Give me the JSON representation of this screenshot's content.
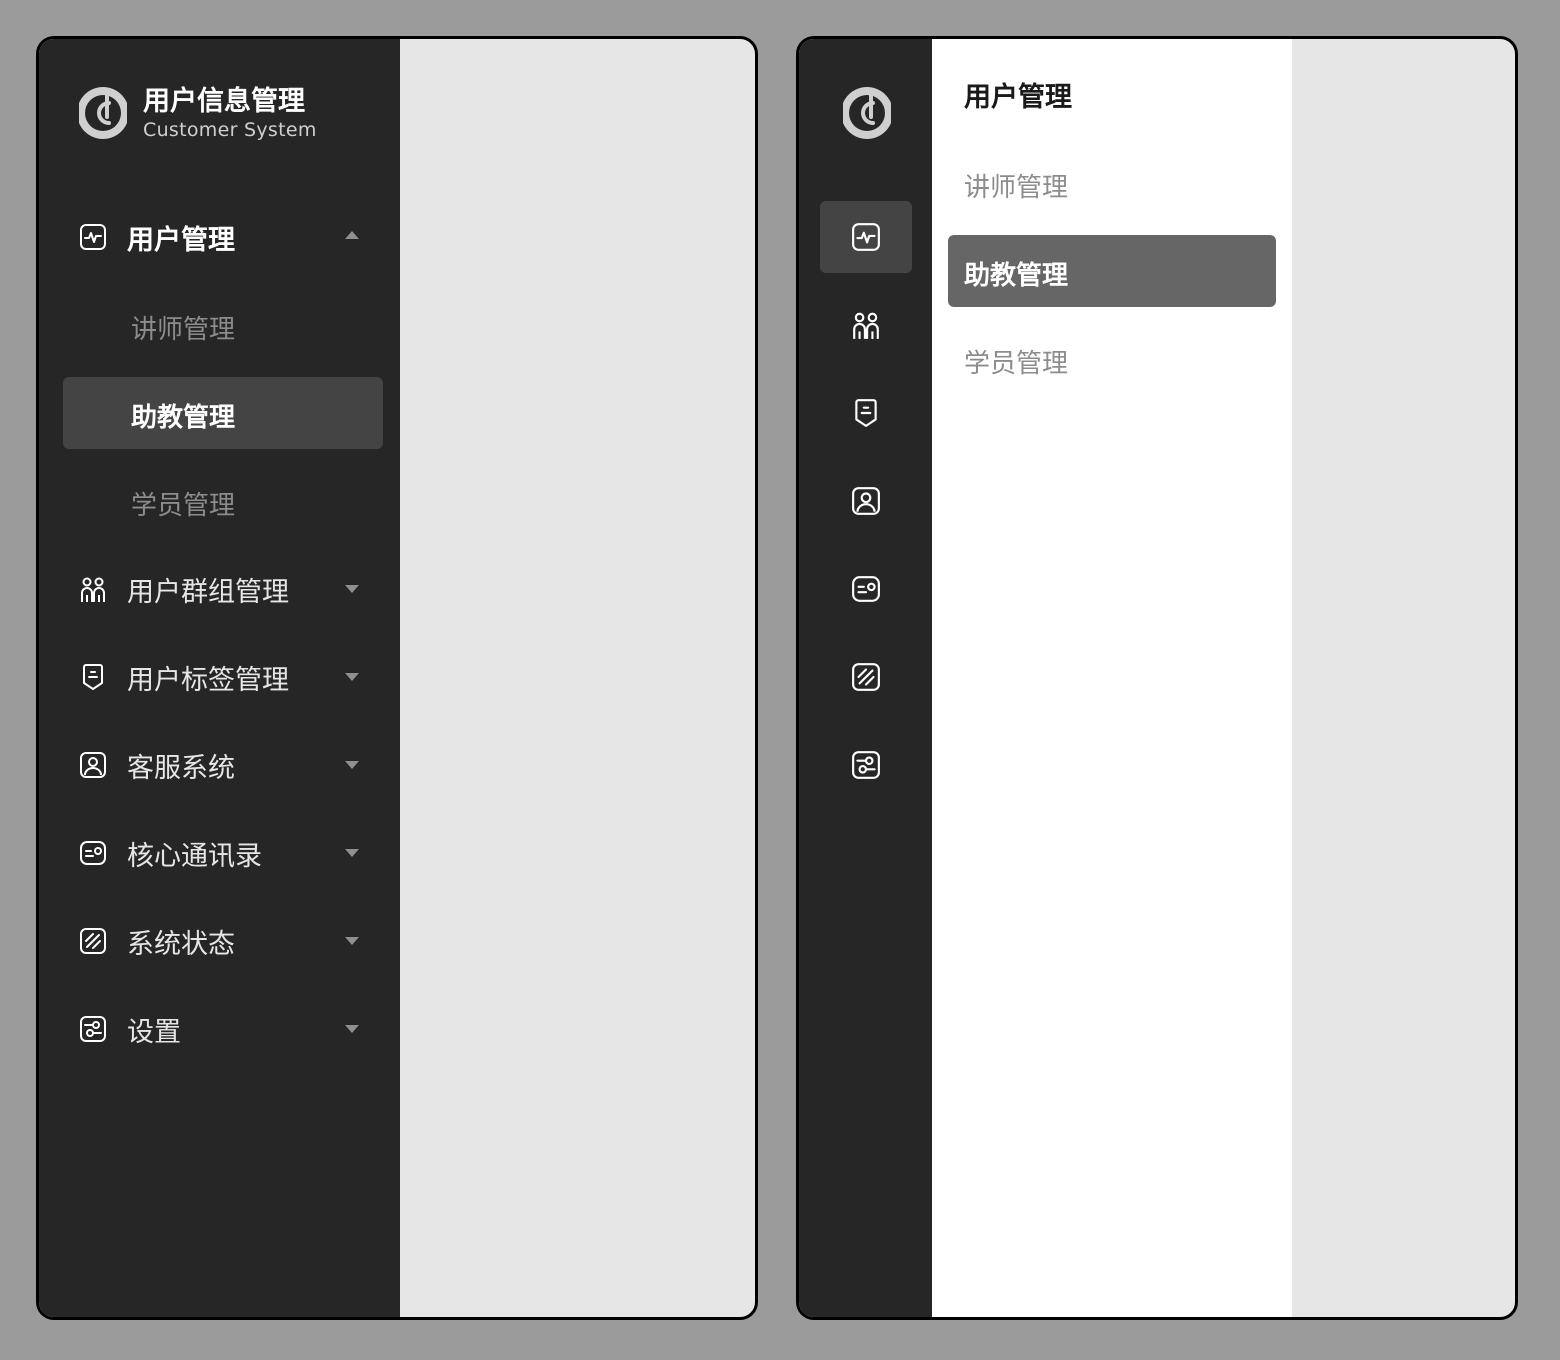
{
  "brand": {
    "title": "用户信息管理",
    "subtitle": "Customer System"
  },
  "colors": {
    "page_bg": "#9b9b9b",
    "sidebar_bg": "#262626",
    "active_item_bg": "#444444",
    "panel_active_bg": "#666666",
    "content_bg": "#e6e6e6",
    "panel_bg": "#ffffff"
  },
  "sidebar": {
    "items": [
      {
        "label": "用户管理",
        "icon": "pulse-icon",
        "expanded": true,
        "children": [
          {
            "label": "讲师管理",
            "active": false
          },
          {
            "label": "助教管理",
            "active": true
          },
          {
            "label": "学员管理",
            "active": false
          }
        ]
      },
      {
        "label": "用户群组管理",
        "icon": "users-icon",
        "expanded": false
      },
      {
        "label": "用户标签管理",
        "icon": "tag-icon",
        "expanded": false
      },
      {
        "label": "客服系统",
        "icon": "user-card-icon",
        "expanded": false
      },
      {
        "label": "核心通讯录",
        "icon": "contact-card-icon",
        "expanded": false
      },
      {
        "label": "系统状态",
        "icon": "status-slash-icon",
        "expanded": false
      },
      {
        "label": "设置",
        "icon": "settings-icon",
        "expanded": false
      }
    ]
  },
  "panel": {
    "title": "用户管理",
    "items": [
      {
        "label": "讲师管理",
        "active": false
      },
      {
        "label": "助教管理",
        "active": true
      },
      {
        "label": "学员管理",
        "active": false
      }
    ]
  }
}
